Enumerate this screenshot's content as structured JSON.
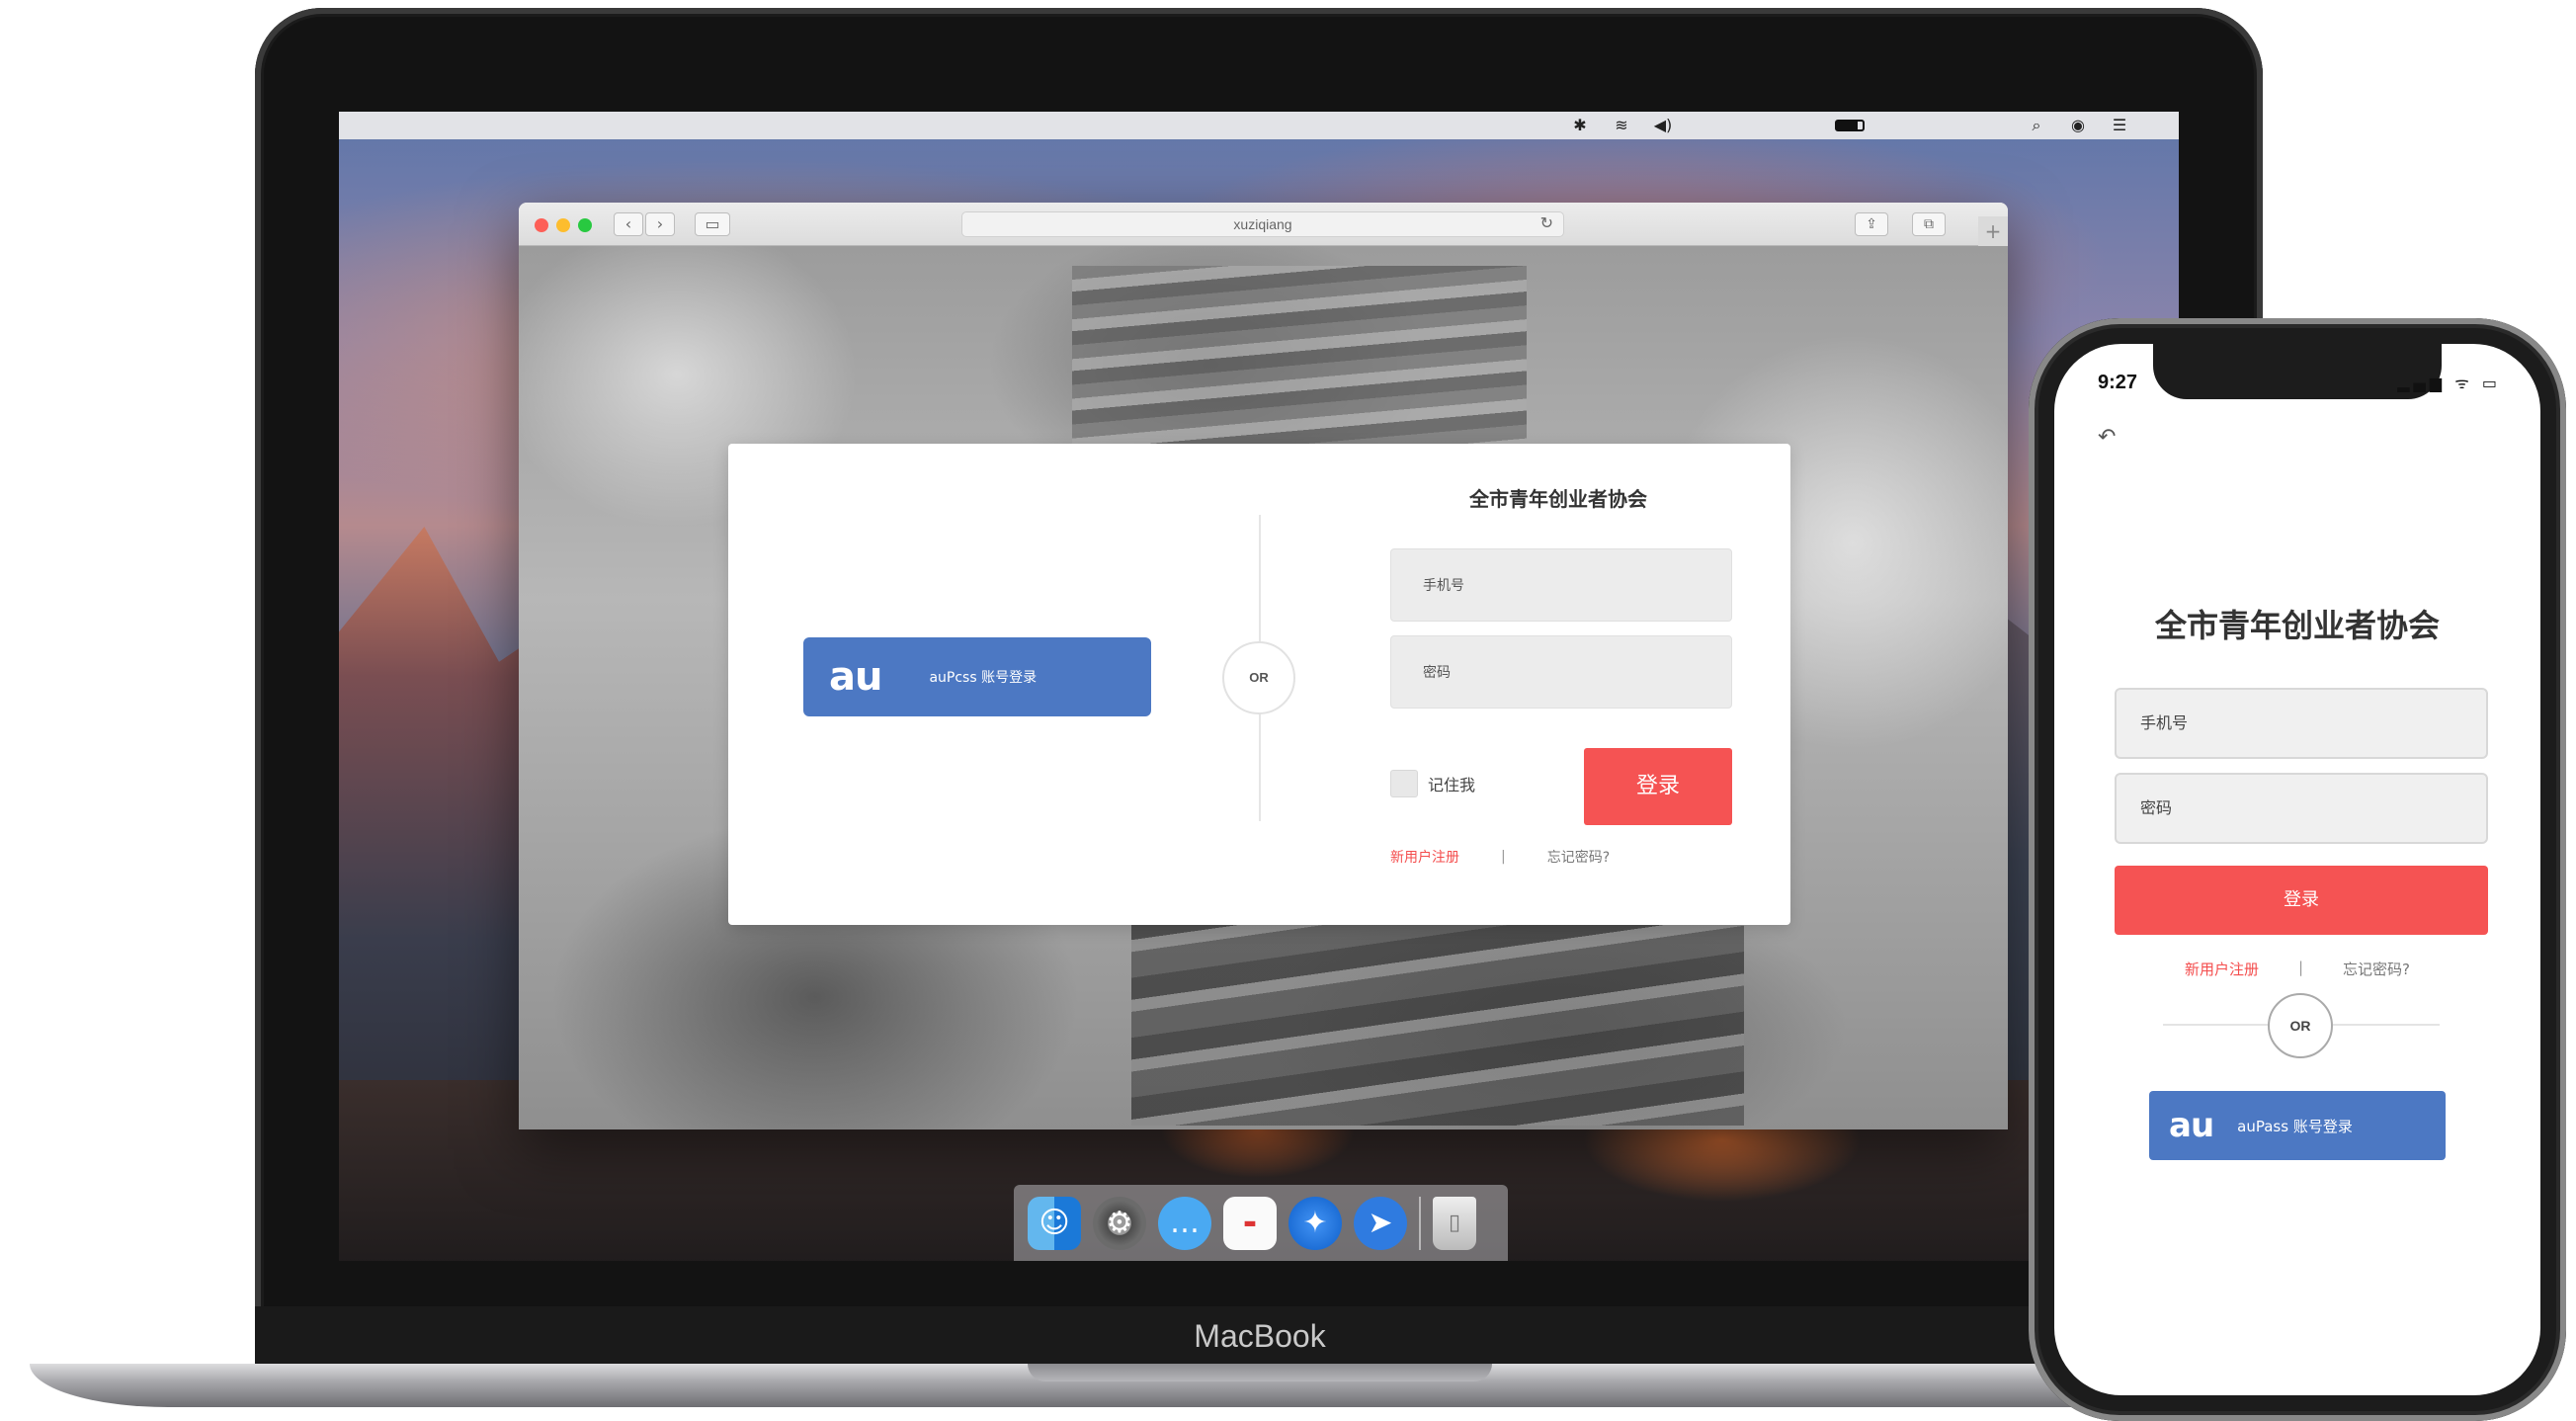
{
  "macbook": {
    "label": "MacBook",
    "menubar": {
      "apple": "",
      "icons": [
        "bluetooth-icon",
        "wifi-icon",
        "volume-icon",
        "battery-icon",
        "spotlight-icon",
        "siri-icon",
        "list-icon"
      ]
    },
    "safari": {
      "url": "xuziqiang",
      "nav_back": "‹",
      "nav_forward": "›",
      "reload": "↻",
      "plus": "+"
    },
    "login_card": {
      "title": "全市青年创业者协会",
      "au_logo": "au",
      "au_label": "auPcss 账号登录",
      "or_label": "OR",
      "phone_placeholder": "手机号",
      "password_placeholder": "密码",
      "remember_label": "记住我",
      "login_label": "登录",
      "register_link": "新用户注册",
      "separator": "|",
      "forgot_link": "忘记密码?"
    },
    "dock": {
      "apps": [
        "finder-icon",
        "system-preferences-icon",
        "messages-icon",
        "calendar-icon",
        "safari-icon",
        "swift-icon",
        "trash-icon"
      ]
    }
  },
  "iphone": {
    "time": "9:27",
    "status": "▂▄▆ ᯤ ▭",
    "back": "↶",
    "title": "全市青年创业者协会",
    "phone_placeholder": "手机号",
    "password_placeholder": "密码",
    "login_label": "登录",
    "register_link": "新用户注册",
    "separator": "|",
    "forgot_link": "忘记密码?",
    "or_label": "OR",
    "au_logo": "au",
    "au_label": "auPass 账号登录"
  },
  "colors": {
    "accent_red": "#f55353",
    "au_blue": "#4c78c3"
  }
}
